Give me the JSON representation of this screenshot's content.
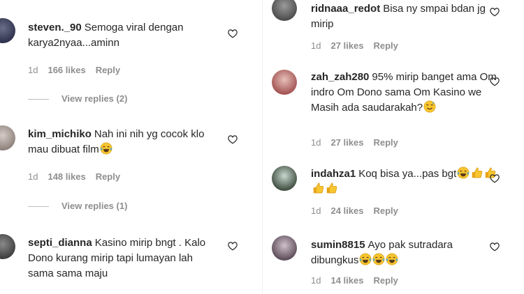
{
  "left_comments": [
    {
      "username": "steven._90",
      "text": "Semoga viral dengan karya2nyaa...aminn",
      "emojis": [],
      "age": "1d",
      "likes": "166 likes",
      "reply": "Reply",
      "view_replies": "View replies (2)"
    },
    {
      "username": "kim_michiko",
      "text": "Nah ini nih yg cocok klo mau dibuat film",
      "emojis": [
        "tears-of-joy"
      ],
      "age": "1d",
      "likes": "148 likes",
      "reply": "Reply",
      "view_replies": "View replies (1)"
    },
    {
      "username": "septi_dianna",
      "text": "Kasino mirip bngt . Kalo Dono kurang mirip tapi lumayan lah sama sama maju",
      "emojis": [],
      "age": "",
      "likes": "",
      "reply": "",
      "view_replies": ""
    }
  ],
  "right_comments": [
    {
      "username": "ridnaaa_redot",
      "text": "Bisa  ny smpai bdan jg mirip",
      "emojis": [],
      "age": "1d",
      "likes": "27 likes",
      "reply": "Reply"
    },
    {
      "username": "zah_zah280",
      "text": "95% mirip banget ama Om indro Om Dono sama Om Kasino we Masih ada saudarakah?",
      "emojis": [
        "sweat-smile"
      ],
      "age": "1d",
      "likes": "27 likes",
      "reply": "Reply"
    },
    {
      "username": "indahza1",
      "text": "Koq bisa ya...pas bgt",
      "emojis": [
        "tears-of-joy",
        "thumbs-up",
        "thumbs-up",
        "thumbs-up",
        "thumbs-up"
      ],
      "age": "1d",
      "likes": "24 likes",
      "reply": "Reply"
    },
    {
      "username": "sumin8815",
      "text": "Ayo pak sutradara dibungkus",
      "emojis": [
        "tears-of-joy",
        "tears-of-joy",
        "tears-of-joy"
      ],
      "age": "1d",
      "likes": "14 likes",
      "reply": "Reply"
    }
  ],
  "colors": {
    "text": "#262626",
    "meta": "#8e8e8e",
    "emoji_face": "#f7c52f",
    "emoji_tears": "#3aa7e8"
  }
}
